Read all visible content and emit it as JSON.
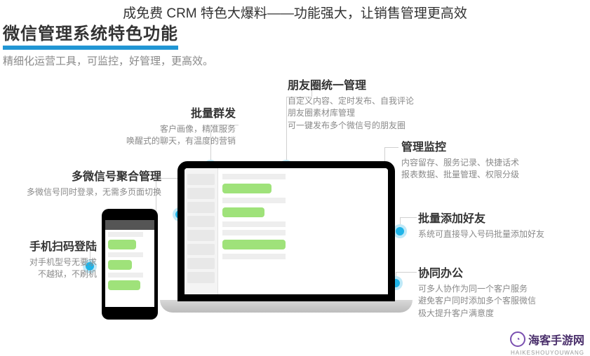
{
  "top_title": "成免费 CRM 特色大爆料——功能强大，让销售管理更高效",
  "section_title": "微信管理系统特色功能",
  "subtitle": "精细化运营工具，可监控，好管理，更高效。",
  "features": {
    "moments": {
      "title": "朋友圈统一管理",
      "desc": "自定义内容、定时发布、自我评论\n朋友圈素材库管理\n可一键发布多个微信号的朋友圈"
    },
    "batch_send": {
      "title": "批量群发",
      "desc": "客户画像，精准服务\n唤醒式的聊天，有温度的营销"
    },
    "monitor": {
      "title": "管理监控",
      "desc": "内容留存、服务记录、快捷话术\n报表数据、批量管理、权限分级"
    },
    "multi_account": {
      "title": "多微信号聚合管理",
      "desc": "多微信号同时登录，无需多页面切换"
    },
    "batch_add": {
      "title": "批量添加好友",
      "desc": "系统可直接导入号码批量添加好友"
    },
    "scan_login": {
      "title": "手机扫码登陆",
      "desc": "对手机型号无要求\n不越狱，不刷机"
    },
    "collab": {
      "title": "协同办公",
      "desc": "可多人协作为同一个客户服务\n避免客户同时添加多个客服微信\n极大提升客户满意度"
    }
  },
  "watermark": {
    "brand": "海客手游网",
    "url": "HAIKESHOUYOUWANG"
  }
}
